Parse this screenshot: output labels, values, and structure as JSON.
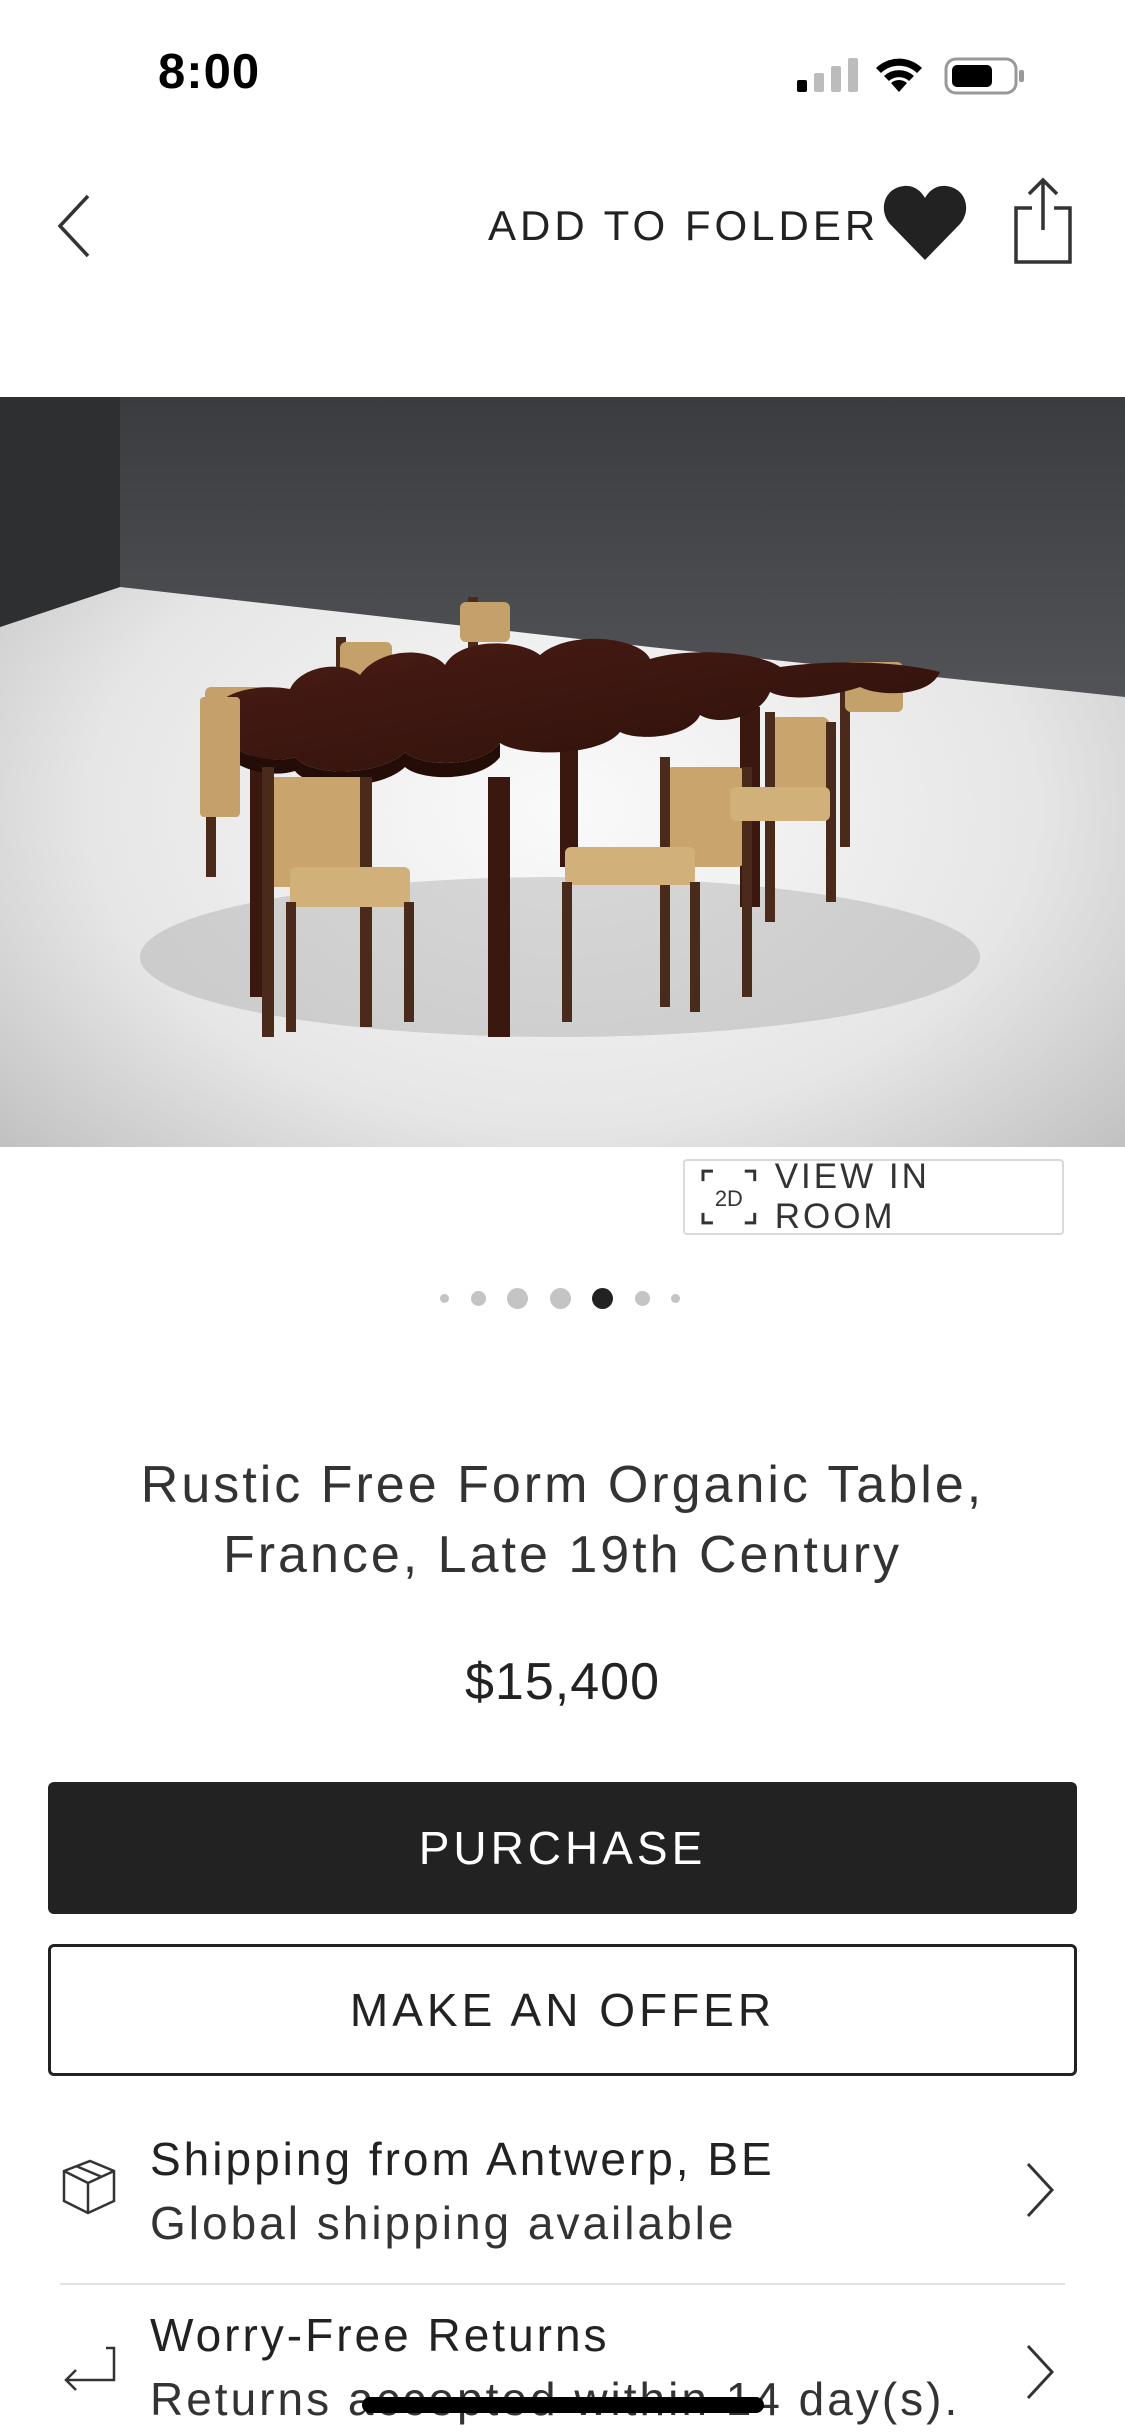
{
  "status_bar": {
    "time": "8:00"
  },
  "nav": {
    "add_to_folder": "ADD TO FOLDER"
  },
  "view_in_room": {
    "badge": "2D",
    "label": "VIEW IN ROOM"
  },
  "carousel": {
    "total": 7,
    "active_index": 4
  },
  "product": {
    "title": "Rustic Free Form Organic Table, France, Late 19th Century",
    "price": "$15,400"
  },
  "actions": {
    "purchase": "PURCHASE",
    "offer": "MAKE AN OFFER"
  },
  "shipping": {
    "title": "Shipping from Antwerp, BE",
    "subtitle": "Global shipping available"
  },
  "returns": {
    "title": "Worry-Free Returns",
    "subtitle": "Returns accepted within 14 day(s)."
  },
  "icons": {
    "back": "chevron-left-icon",
    "heart": "heart-filled-icon",
    "share": "share-icon",
    "shipping": "package-icon",
    "returns": "return-arrow-icon",
    "chevron": "chevron-right-icon"
  },
  "colors": {
    "primary": "#222222",
    "border": "#d9d9d9",
    "dot_inactive": "#c4c4c4"
  }
}
